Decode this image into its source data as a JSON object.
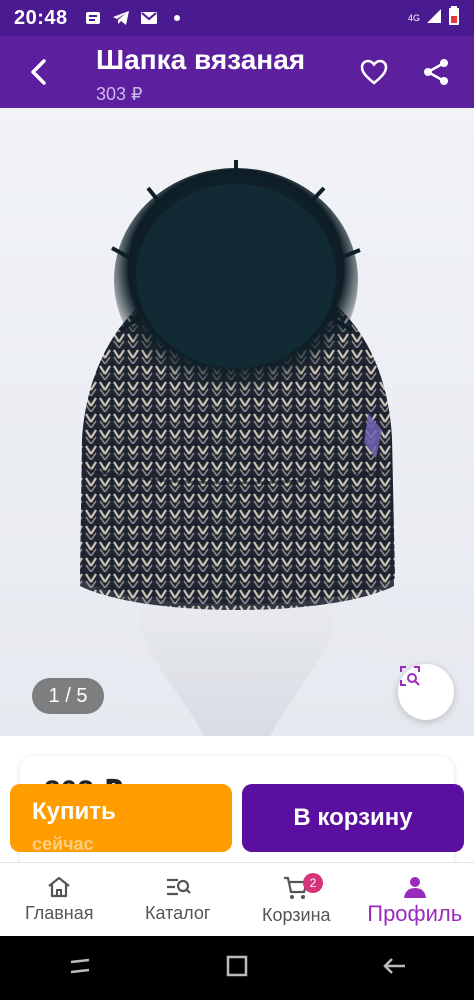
{
  "status_bar": {
    "time": "20:48",
    "notification_icons": [
      "message-icon",
      "telegram-icon",
      "mail-icon",
      "dot-icon"
    ],
    "network": "4G"
  },
  "header": {
    "title": "Шапка вязаная",
    "price": "303 ₽"
  },
  "gallery": {
    "counter": "1 / 5"
  },
  "info_card": {
    "price": "303 ₽"
  },
  "actions": {
    "buy_label": "Купить",
    "buy_sub": "сейчас",
    "cart_label": "В корзину"
  },
  "bottom_nav": {
    "items": [
      {
        "label": "Главная",
        "icon": "home-icon"
      },
      {
        "label": "Каталог",
        "icon": "catalog-icon"
      },
      {
        "label": "Корзина",
        "icon": "cart-icon",
        "badge": "2"
      },
      {
        "label": "Профиль",
        "icon": "profile-icon",
        "active": true
      }
    ]
  },
  "colors": {
    "header_bg": "#5c1f9e",
    "buy_button": "#ff9d00",
    "cart_button": "#5a0fa0",
    "active_nav": "#9b2bbd"
  }
}
